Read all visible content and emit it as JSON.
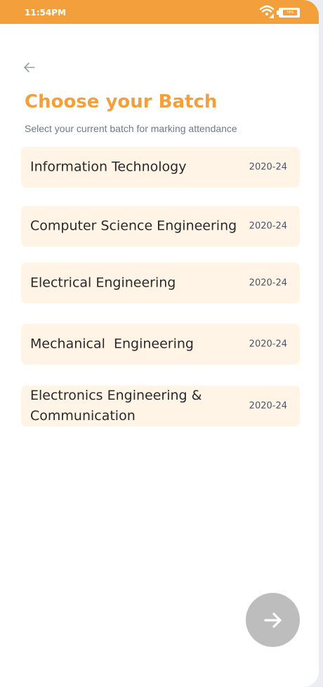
{
  "status_bar": {
    "time": "11:54PM",
    "battery_text": "78%",
    "battery_level": 0.78,
    "color": "#f29f3c"
  },
  "header": {
    "back_icon": "arrow-left-icon",
    "title": "Choose your Batch",
    "subtitle": "Select your current batch for marking attendance"
  },
  "batches": [
    {
      "name": "Information Technology",
      "year": "2020-24"
    },
    {
      "name": "Computer Science Engineering",
      "year": "2020-24"
    },
    {
      "name": "Electrical Engineering",
      "year": "2020-24"
    },
    {
      "name": "Mechanical  Engineering",
      "year": "2020-24"
    },
    {
      "name": "Electronics Engineering & Communication",
      "year": "2020-24"
    }
  ],
  "next_button": {
    "icon": "arrow-right-icon",
    "color": "#bdbdbd"
  },
  "colors": {
    "accent": "#f29f3c",
    "card_background": "#fff4e5"
  }
}
